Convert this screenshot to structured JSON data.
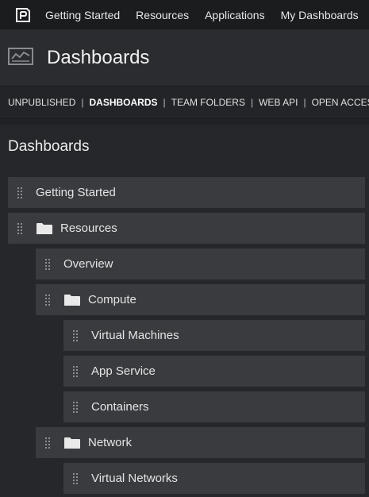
{
  "topnav": {
    "items": [
      "Getting Started",
      "Resources",
      "Applications",
      "My Dashboards"
    ]
  },
  "header": {
    "title": "Dashboards"
  },
  "subnav": {
    "items": [
      "UNPUBLISHED",
      "DASHBOARDS",
      "TEAM FOLDERS",
      "WEB API",
      "OPEN ACCESS"
    ],
    "active": "DASHBOARDS"
  },
  "main": {
    "section_title": "Dashboards",
    "tree": [
      {
        "label": "Getting Started",
        "folder": false,
        "level": 0
      },
      {
        "label": "Resources",
        "folder": true,
        "level": 0
      },
      {
        "label": "Overview",
        "folder": false,
        "level": 1
      },
      {
        "label": "Compute",
        "folder": true,
        "level": 1
      },
      {
        "label": "Virtual Machines",
        "folder": false,
        "level": 2
      },
      {
        "label": "App Service",
        "folder": false,
        "level": 2
      },
      {
        "label": "Containers",
        "folder": false,
        "level": 2
      },
      {
        "label": "Network",
        "folder": true,
        "level": 1
      },
      {
        "label": "Virtual Networks",
        "folder": false,
        "level": 2
      }
    ]
  },
  "icons": {
    "logo": "app-logo-icon",
    "header": "dashboard-chart-icon",
    "grip": "drag-handle-icon",
    "folder": "folder-icon"
  }
}
